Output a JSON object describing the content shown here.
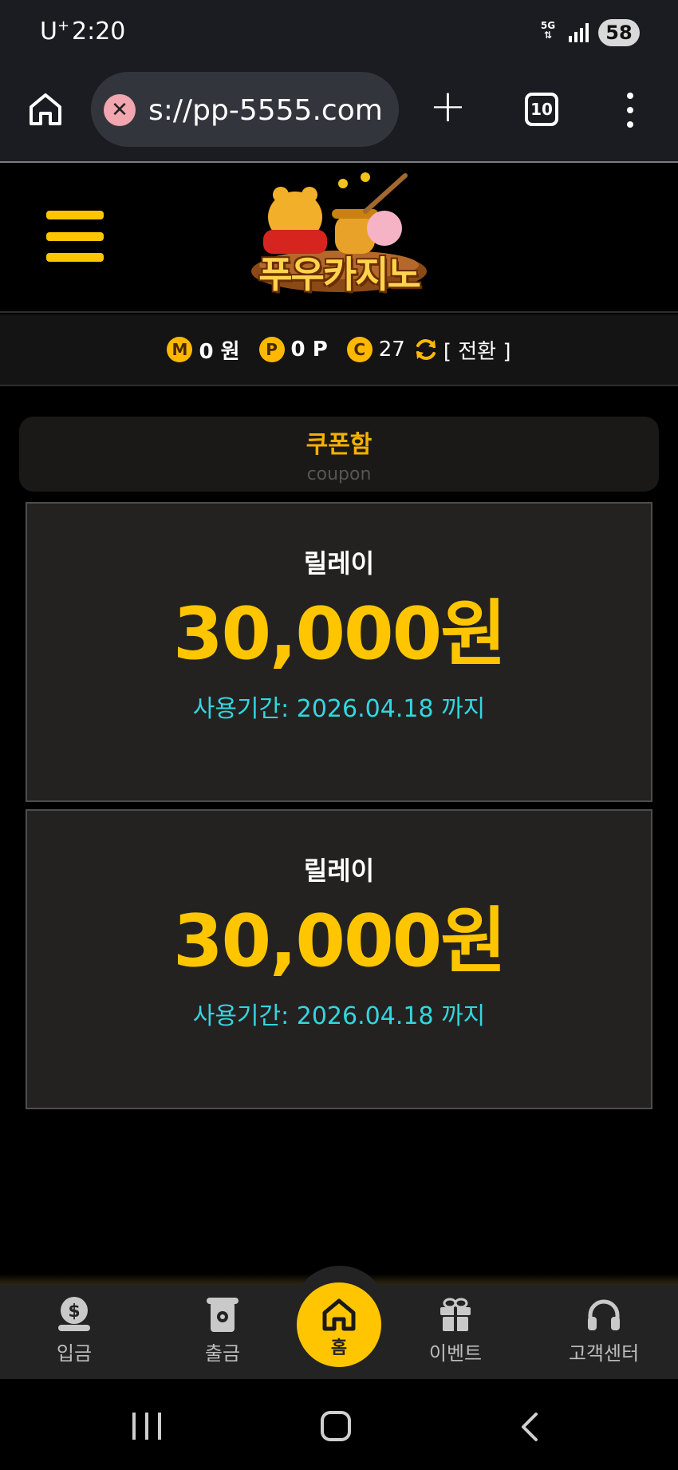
{
  "status_bar": {
    "carrier": "U",
    "carrier_sup": "+",
    "time": "2:20",
    "network": "5G",
    "battery": "58"
  },
  "browser": {
    "url": "s://pp-5555.com",
    "tab_count": "10"
  },
  "header": {
    "logo_text": "푸우카지노"
  },
  "balance": {
    "money_badge": "M",
    "money": "0 원",
    "point_badge": "P",
    "point": "0 P",
    "coin_badge": "C",
    "coin": "27",
    "switch_label": "[ 전환 ]"
  },
  "coupon_box": {
    "title": "쿠폰함",
    "subtitle": "coupon"
  },
  "coupons": [
    {
      "name": "릴레이",
      "amount": "30,000원",
      "period": "사용기간: 2026.04.18 까지"
    },
    {
      "name": "릴레이",
      "amount": "30,000원",
      "period": "사용기간: 2026.04.18 까지"
    }
  ],
  "bottom_nav": {
    "deposit": "입금",
    "withdraw": "출금",
    "home": "홈",
    "event": "이벤트",
    "support": "고객센터"
  },
  "colors": {
    "accent": "#ffc600",
    "period_text": "#33d6e0"
  }
}
